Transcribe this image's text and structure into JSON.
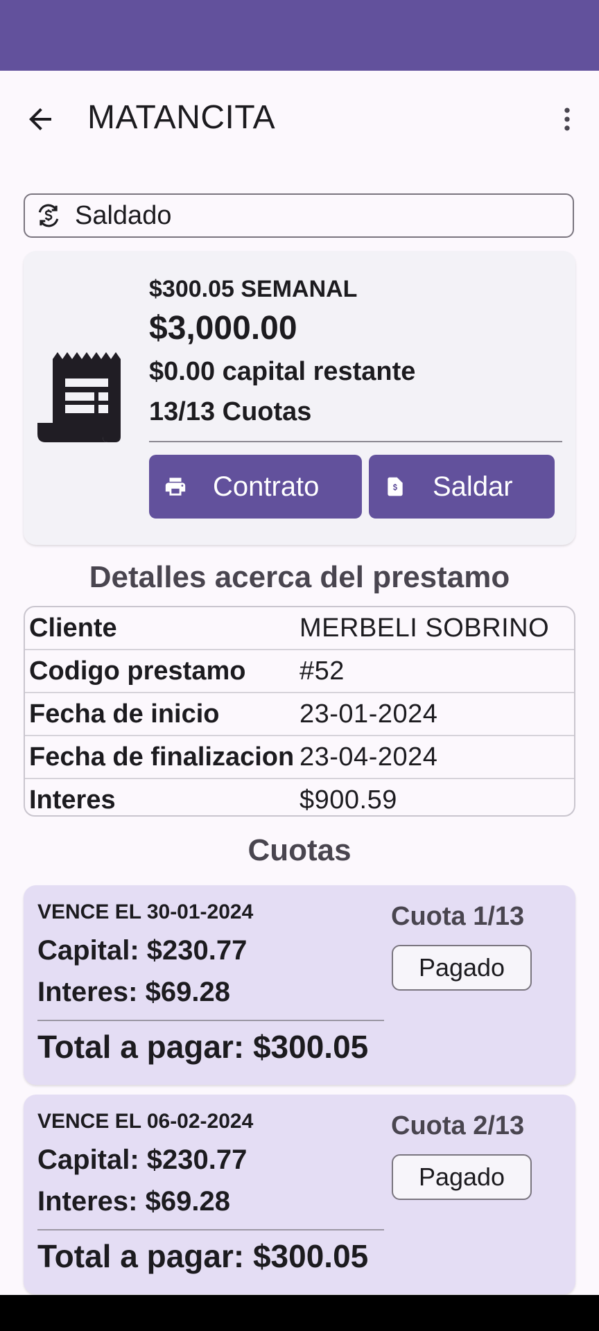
{
  "app_bar": {
    "title": "MATANCITA",
    "back_icon": "arrow-back-icon",
    "menu_icon": "more-vert-icon"
  },
  "status_chip": {
    "label": "Saldado",
    "icon": "currency-exchange-icon"
  },
  "loan_summary": {
    "icon": "receipt-icon",
    "frequency": "$300.05 SEMANAL",
    "amount": "$3,000.00",
    "remaining": "$0.00 capital restante",
    "cuotas": "13/13 Cuotas",
    "buttons": {
      "contrato": {
        "label": "Contrato",
        "icon": "print-icon"
      },
      "saldar": {
        "label": "Saldar",
        "icon": "invoice-icon"
      }
    }
  },
  "details": {
    "title": "Detalles acerca del prestamo",
    "rows": [
      {
        "key": "Cliente",
        "value": "MERBELI SOBRINO"
      },
      {
        "key": "Codigo prestamo",
        "value": "#52"
      },
      {
        "key": "Fecha de inicio",
        "value": "23-01-2024"
      },
      {
        "key": "Fecha de finalizacion",
        "value": "23-04-2024"
      },
      {
        "key": "Interes",
        "value": "$900.59"
      }
    ]
  },
  "cuotas_section": {
    "title": "Cuotas",
    "items": [
      {
        "due": "VENCE EL 30-01-2024",
        "capital": "Capital: $230.77",
        "interes": "Interes: $69.28",
        "total": "Total a pagar: $300.05",
        "number": "Cuota 1/13",
        "status": "Pagado"
      },
      {
        "due": "VENCE EL 06-02-2024",
        "capital": "Capital: $230.77",
        "interes": "Interes: $69.28",
        "total": "Total a pagar: $300.05",
        "number": "Cuota 2/13",
        "status": "Pagado"
      }
    ]
  },
  "colors": {
    "primary": "#62519c",
    "background": "#fcf8fd",
    "card": "#f3f2f7",
    "cuota_card": "#e4ddf4"
  }
}
